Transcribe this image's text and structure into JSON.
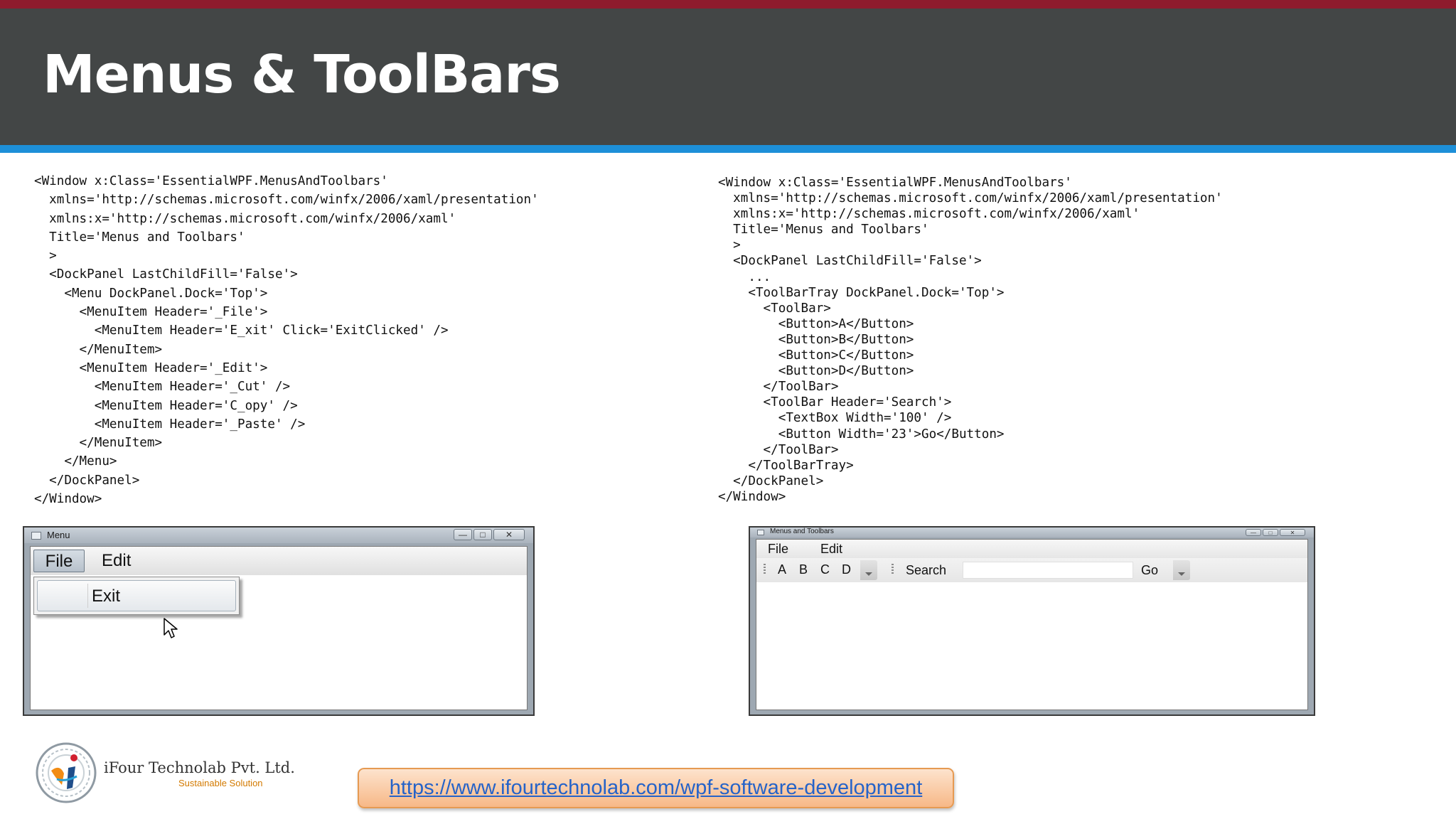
{
  "slide": {
    "title": "Menus & ToolBars"
  },
  "code_left": "<Window x:Class='EssentialWPF.MenusAndToolbars'\n  xmlns='http://schemas.microsoft.com/winfx/2006/xaml/presentation'\n  xmlns:x='http://schemas.microsoft.com/winfx/2006/xaml'\n  Title='Menus and Toolbars'\n  >\n  <DockPanel LastChildFill='False'>\n    <Menu DockPanel.Dock='Top'>\n      <MenuItem Header='_File'>\n        <MenuItem Header='E_xit' Click='ExitClicked' />\n      </MenuItem>\n      <MenuItem Header='_Edit'>\n        <MenuItem Header='_Cut' />\n        <MenuItem Header='C_opy' />\n        <MenuItem Header='_Paste' />\n      </MenuItem>\n    </Menu>\n  </DockPanel>\n</Window>",
  "code_right": "<Window x:Class='EssentialWPF.MenusAndToolbars'\n  xmlns='http://schemas.microsoft.com/winfx/2006/xaml/presentation'\n  xmlns:x='http://schemas.microsoft.com/winfx/2006/xaml'\n  Title='Menus and Toolbars'\n  >\n  <DockPanel LastChildFill='False'>\n    ...\n    <ToolBarTray DockPanel.Dock='Top'>\n      <ToolBar>\n        <Button>A</Button>\n        <Button>B</Button>\n        <Button>C</Button>\n        <Button>D</Button>\n      </ToolBar>\n      <ToolBar Header='Search'>\n        <TextBox Width='100' />\n        <Button Width='23'>Go</Button>\n      </ToolBar>\n    </ToolBarTray>\n  </DockPanel>\n</Window>",
  "window_left": {
    "title": "Menu",
    "menu": {
      "file": "File",
      "edit": "Edit"
    },
    "dropdown_item": "Exit"
  },
  "window_right": {
    "title": "Menus and Toolbars",
    "menu": {
      "file": "File",
      "edit": "Edit"
    },
    "toolbar1": [
      "A",
      "B",
      "C",
      "D"
    ],
    "toolbar2": {
      "header": "Search",
      "go": "Go"
    }
  },
  "window_controls": {
    "minimize": "—",
    "maximize": "□",
    "close": "✕"
  },
  "icons": {
    "window_icon": "window-icon",
    "mouse_cursor": "mouse-cursor-icon",
    "logo": "ifour-logo-icon"
  },
  "footer": {
    "company": "iFour Technolab Pvt. Ltd.",
    "tagline": "Sustainable Solution",
    "link": "https://www.ifourtechnolab.com/wpf-software-development"
  },
  "colors": {
    "top_strip": "#8e1b2d",
    "title_background": "#434646",
    "accent_blue": "#1d8fd8",
    "link_box": "#f7b887",
    "link_text": "#2563c9",
    "tagline": "#d37a00"
  }
}
